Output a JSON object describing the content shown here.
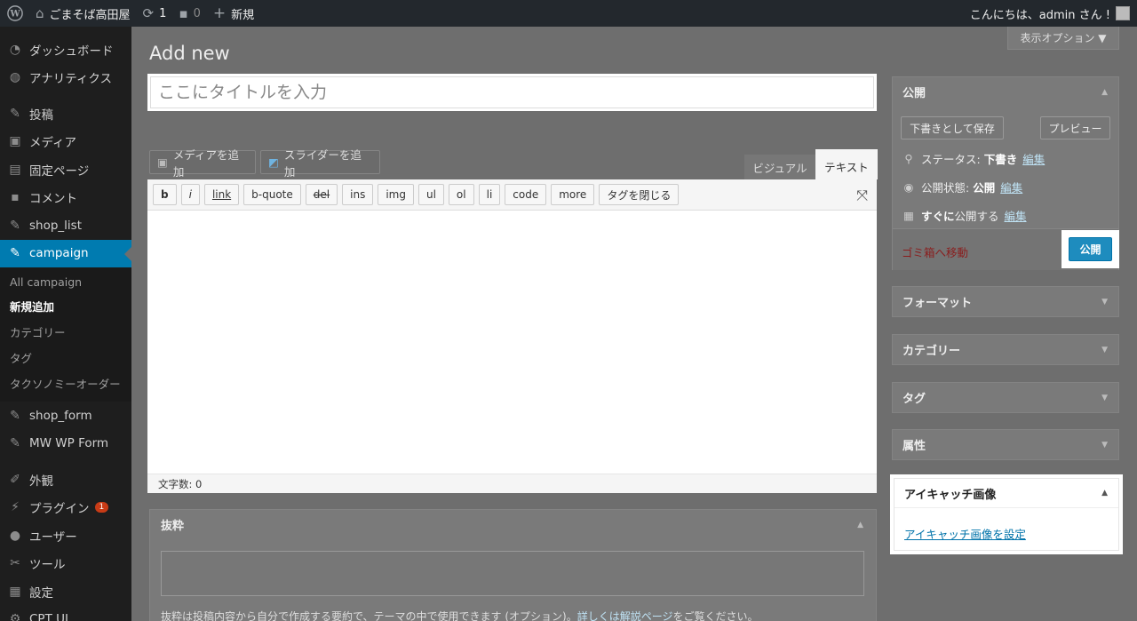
{
  "adminbar": {
    "site_name": "ごまそば高田屋",
    "updates_count": "1",
    "comments_count": "0",
    "new_label": "新規",
    "greeting": "こんにちは、admin さん !"
  },
  "sidebar": {
    "items": [
      {
        "label": "ダッシュボード",
        "icon": "dashboard-icon"
      },
      {
        "label": "アナリティクス",
        "icon": "analytics-icon"
      },
      {
        "label": "投稿",
        "icon": "pin-icon"
      },
      {
        "label": "メディア",
        "icon": "media-icon"
      },
      {
        "label": "固定ページ",
        "icon": "page-icon"
      },
      {
        "label": "コメント",
        "icon": "comment-icon"
      },
      {
        "label": "shop_list",
        "icon": "pin-icon"
      },
      {
        "label": "campaign",
        "icon": "pin-icon"
      },
      {
        "label": "shop_form",
        "icon": "pin-icon"
      },
      {
        "label": "MW WP Form",
        "icon": "pin-icon"
      },
      {
        "label": "外観",
        "icon": "brush-icon"
      },
      {
        "label": "プラグイン",
        "icon": "plugin-icon",
        "badge": "1"
      },
      {
        "label": "ユーザー",
        "icon": "user-icon"
      },
      {
        "label": "ツール",
        "icon": "wrench-icon"
      },
      {
        "label": "設定",
        "icon": "settings-icon"
      },
      {
        "label": "CPT UI",
        "icon": "gear-icon"
      }
    ],
    "submenu": [
      "All campaign",
      "新規追加",
      "カテゴリー",
      "タグ",
      "タクソノミーオーダー"
    ]
  },
  "screen_options": "表示オプション ▼",
  "page_title": "Add new",
  "title_placeholder": "ここにタイトルを入力",
  "media_buttons": {
    "add_media": "メディアを追加",
    "add_slider": "スライダーを追加"
  },
  "editor_tabs": {
    "visual": "ビジュアル",
    "text": "テキスト"
  },
  "quicktags": [
    "b",
    "i",
    "link",
    "b-quote",
    "del",
    "ins",
    "img",
    "ul",
    "ol",
    "li",
    "code",
    "more",
    "タグを閉じる"
  ],
  "word_count": "文字数: 0",
  "excerpt": {
    "title": "抜粋",
    "desc_pre": "抜粋は投稿内容から自分で作成する要約で、テーマの中で使用できます (オプション)。",
    "desc_link": "詳しくは解説ページ",
    "desc_post": "をご覧ください。"
  },
  "publish": {
    "title": "公開",
    "save_draft": "下書きとして保存",
    "preview": "プレビュー",
    "status_label": "ステータス:",
    "status_value": "下書き",
    "visibility_label": "公開状態:",
    "visibility_value": "公開",
    "schedule_bold": "すぐに",
    "schedule_rest": "公開する",
    "edit": "編集",
    "trash": "ゴミ箱へ移動",
    "publish_button": "公開"
  },
  "boxes": {
    "format": "フォーマット",
    "category": "カテゴリー",
    "tag": "タグ",
    "attributes": "属性"
  },
  "featured": {
    "title": "アイキャッチ画像",
    "link": "アイキャッチ画像を設定"
  }
}
